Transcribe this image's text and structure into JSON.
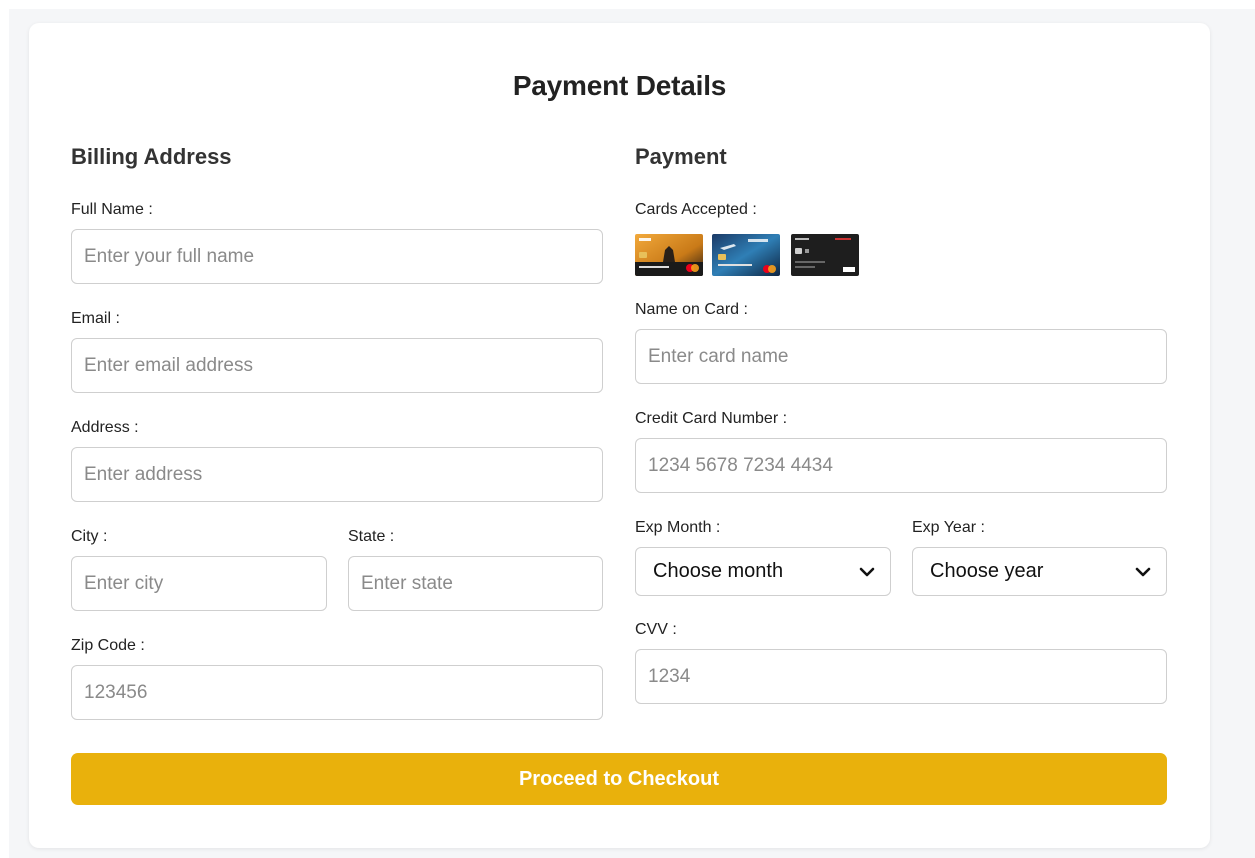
{
  "title": "Payment Details",
  "billing": {
    "heading": "Billing Address",
    "full_name": {
      "label": "Full Name :",
      "placeholder": "Enter your full name"
    },
    "email": {
      "label": "Email :",
      "placeholder": "Enter email address"
    },
    "address": {
      "label": "Address :",
      "placeholder": "Enter address"
    },
    "city": {
      "label": "City :",
      "placeholder": "Enter city"
    },
    "state": {
      "label": "State :",
      "placeholder": "Enter state"
    },
    "zip": {
      "label": "Zip Code :",
      "placeholder": "123456"
    }
  },
  "payment": {
    "heading": "Payment",
    "cards_label": "Cards Accepted :",
    "cards": [
      "mastercard-gold-card",
      "mastercard-blue-card",
      "visa-black-card"
    ],
    "name_on_card": {
      "label": "Name on Card :",
      "placeholder": "Enter card name"
    },
    "card_number": {
      "label": "Credit Card Number :",
      "placeholder": "1234 5678 7234 4434"
    },
    "exp_month": {
      "label": "Exp Month :",
      "selected": "Choose month"
    },
    "exp_year": {
      "label": "Exp Year :",
      "selected": "Choose year"
    },
    "cvv": {
      "label": "CVV :",
      "placeholder": "1234"
    }
  },
  "submit_label": "Proceed to Checkout",
  "colors": {
    "accent": "#e9b10c",
    "page_background": "#f5f6f8",
    "card_background": "#ffffff",
    "input_border": "#cfcfcf"
  }
}
